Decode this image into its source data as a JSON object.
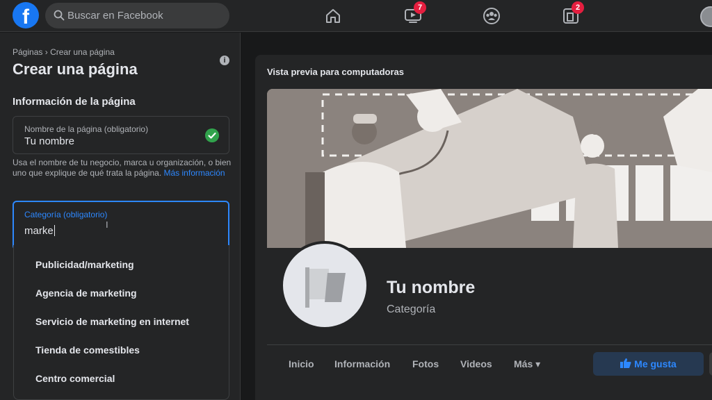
{
  "topbar": {
    "logo_letter": "f",
    "search_placeholder": "Buscar en Facebook",
    "nav": [
      {
        "name": "home-icon"
      },
      {
        "name": "watch-icon",
        "badge": "7"
      },
      {
        "name": "groups-icon"
      },
      {
        "name": "gaming-icon",
        "badge": "2"
      }
    ]
  },
  "sidebar": {
    "breadcrumb_root": "Páginas",
    "breadcrumb_sep": "›",
    "breadcrumb_current": "Crear una página",
    "title": "Crear una página",
    "info_glyph": "i",
    "section_title": "Información de la página",
    "name_field": {
      "label": "Nombre de la página (obligatorio)",
      "value": "Tu nombre"
    },
    "help_text": "Usa el nombre de tu negocio, marca u organización, o bien uno que explique de qué trata la página.",
    "help_link": "Más información",
    "category_field": {
      "label": "Categoría (obligatorio)",
      "value": "marke"
    },
    "suggestions": [
      "Publicidad/marketing",
      "Agencia de marketing",
      "Servicio de marketing en internet",
      "Tienda de comestibles",
      "Centro comercial"
    ]
  },
  "preview": {
    "title": "Vista previa para computadoras",
    "page_name": "Tu nombre",
    "page_category": "Categoría",
    "tabs": [
      "Inicio",
      "Información",
      "Fotos",
      "Videos",
      "Más ▾"
    ],
    "like_button": "Me gusta"
  },
  "colors": {
    "accent": "#2d88ff",
    "brand": "#1877f2",
    "success": "#31a24c",
    "badge": "#e41e3f"
  }
}
